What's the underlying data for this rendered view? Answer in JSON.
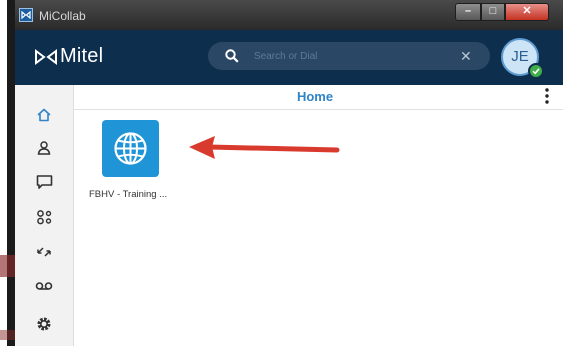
{
  "window": {
    "title": "MiCollab",
    "controls": {
      "minimize": "–",
      "maximize": "□",
      "close": "✕"
    }
  },
  "header": {
    "logo_text": "Mitel",
    "search": {
      "placeholder": "Search or Dial",
      "value": ""
    },
    "avatar": {
      "initials": "JE",
      "presence": "available"
    }
  },
  "sidebar": {
    "items": [
      {
        "icon": "home-icon"
      },
      {
        "icon": "contacts-icon"
      },
      {
        "icon": "chat-icon"
      },
      {
        "icon": "conference-icon"
      },
      {
        "icon": "call-history-icon"
      },
      {
        "icon": "voicemail-icon"
      },
      {
        "icon": "settings-icon"
      }
    ]
  },
  "main": {
    "title": "Home",
    "tiles": [
      {
        "label": "FBHV - Training ...",
        "icon": "globe-icon"
      }
    ]
  },
  "colors": {
    "header": "#0e2e4d",
    "accent": "#2f83c7",
    "tile": "#1f95d8",
    "annotation_arrow": "#d93a2e",
    "presence": "#3fae49"
  }
}
